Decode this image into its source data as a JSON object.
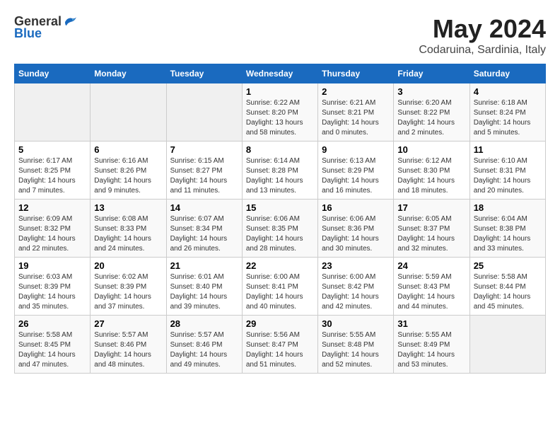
{
  "header": {
    "logo_general": "General",
    "logo_blue": "Blue",
    "month_title": "May 2024",
    "location": "Codaruina, Sardinia, Italy"
  },
  "weekdays": [
    "Sunday",
    "Monday",
    "Tuesday",
    "Wednesday",
    "Thursday",
    "Friday",
    "Saturday"
  ],
  "weeks": [
    [
      {
        "day": "",
        "info": ""
      },
      {
        "day": "",
        "info": ""
      },
      {
        "day": "",
        "info": ""
      },
      {
        "day": "1",
        "info": "Sunrise: 6:22 AM\nSunset: 8:20 PM\nDaylight: 13 hours\nand 58 minutes."
      },
      {
        "day": "2",
        "info": "Sunrise: 6:21 AM\nSunset: 8:21 PM\nDaylight: 14 hours\nand 0 minutes."
      },
      {
        "day": "3",
        "info": "Sunrise: 6:20 AM\nSunset: 8:22 PM\nDaylight: 14 hours\nand 2 minutes."
      },
      {
        "day": "4",
        "info": "Sunrise: 6:18 AM\nSunset: 8:24 PM\nDaylight: 14 hours\nand 5 minutes."
      }
    ],
    [
      {
        "day": "5",
        "info": "Sunrise: 6:17 AM\nSunset: 8:25 PM\nDaylight: 14 hours\nand 7 minutes."
      },
      {
        "day": "6",
        "info": "Sunrise: 6:16 AM\nSunset: 8:26 PM\nDaylight: 14 hours\nand 9 minutes."
      },
      {
        "day": "7",
        "info": "Sunrise: 6:15 AM\nSunset: 8:27 PM\nDaylight: 14 hours\nand 11 minutes."
      },
      {
        "day": "8",
        "info": "Sunrise: 6:14 AM\nSunset: 8:28 PM\nDaylight: 14 hours\nand 13 minutes."
      },
      {
        "day": "9",
        "info": "Sunrise: 6:13 AM\nSunset: 8:29 PM\nDaylight: 14 hours\nand 16 minutes."
      },
      {
        "day": "10",
        "info": "Sunrise: 6:12 AM\nSunset: 8:30 PM\nDaylight: 14 hours\nand 18 minutes."
      },
      {
        "day": "11",
        "info": "Sunrise: 6:10 AM\nSunset: 8:31 PM\nDaylight: 14 hours\nand 20 minutes."
      }
    ],
    [
      {
        "day": "12",
        "info": "Sunrise: 6:09 AM\nSunset: 8:32 PM\nDaylight: 14 hours\nand 22 minutes."
      },
      {
        "day": "13",
        "info": "Sunrise: 6:08 AM\nSunset: 8:33 PM\nDaylight: 14 hours\nand 24 minutes."
      },
      {
        "day": "14",
        "info": "Sunrise: 6:07 AM\nSunset: 8:34 PM\nDaylight: 14 hours\nand 26 minutes."
      },
      {
        "day": "15",
        "info": "Sunrise: 6:06 AM\nSunset: 8:35 PM\nDaylight: 14 hours\nand 28 minutes."
      },
      {
        "day": "16",
        "info": "Sunrise: 6:06 AM\nSunset: 8:36 PM\nDaylight: 14 hours\nand 30 minutes."
      },
      {
        "day": "17",
        "info": "Sunrise: 6:05 AM\nSunset: 8:37 PM\nDaylight: 14 hours\nand 32 minutes."
      },
      {
        "day": "18",
        "info": "Sunrise: 6:04 AM\nSunset: 8:38 PM\nDaylight: 14 hours\nand 33 minutes."
      }
    ],
    [
      {
        "day": "19",
        "info": "Sunrise: 6:03 AM\nSunset: 8:39 PM\nDaylight: 14 hours\nand 35 minutes."
      },
      {
        "day": "20",
        "info": "Sunrise: 6:02 AM\nSunset: 8:39 PM\nDaylight: 14 hours\nand 37 minutes."
      },
      {
        "day": "21",
        "info": "Sunrise: 6:01 AM\nSunset: 8:40 PM\nDaylight: 14 hours\nand 39 minutes."
      },
      {
        "day": "22",
        "info": "Sunrise: 6:00 AM\nSunset: 8:41 PM\nDaylight: 14 hours\nand 40 minutes."
      },
      {
        "day": "23",
        "info": "Sunrise: 6:00 AM\nSunset: 8:42 PM\nDaylight: 14 hours\nand 42 minutes."
      },
      {
        "day": "24",
        "info": "Sunrise: 5:59 AM\nSunset: 8:43 PM\nDaylight: 14 hours\nand 44 minutes."
      },
      {
        "day": "25",
        "info": "Sunrise: 5:58 AM\nSunset: 8:44 PM\nDaylight: 14 hours\nand 45 minutes."
      }
    ],
    [
      {
        "day": "26",
        "info": "Sunrise: 5:58 AM\nSunset: 8:45 PM\nDaylight: 14 hours\nand 47 minutes."
      },
      {
        "day": "27",
        "info": "Sunrise: 5:57 AM\nSunset: 8:46 PM\nDaylight: 14 hours\nand 48 minutes."
      },
      {
        "day": "28",
        "info": "Sunrise: 5:57 AM\nSunset: 8:46 PM\nDaylight: 14 hours\nand 49 minutes."
      },
      {
        "day": "29",
        "info": "Sunrise: 5:56 AM\nSunset: 8:47 PM\nDaylight: 14 hours\nand 51 minutes."
      },
      {
        "day": "30",
        "info": "Sunrise: 5:55 AM\nSunset: 8:48 PM\nDaylight: 14 hours\nand 52 minutes."
      },
      {
        "day": "31",
        "info": "Sunrise: 5:55 AM\nSunset: 8:49 PM\nDaylight: 14 hours\nand 53 minutes."
      },
      {
        "day": "",
        "info": ""
      }
    ]
  ]
}
